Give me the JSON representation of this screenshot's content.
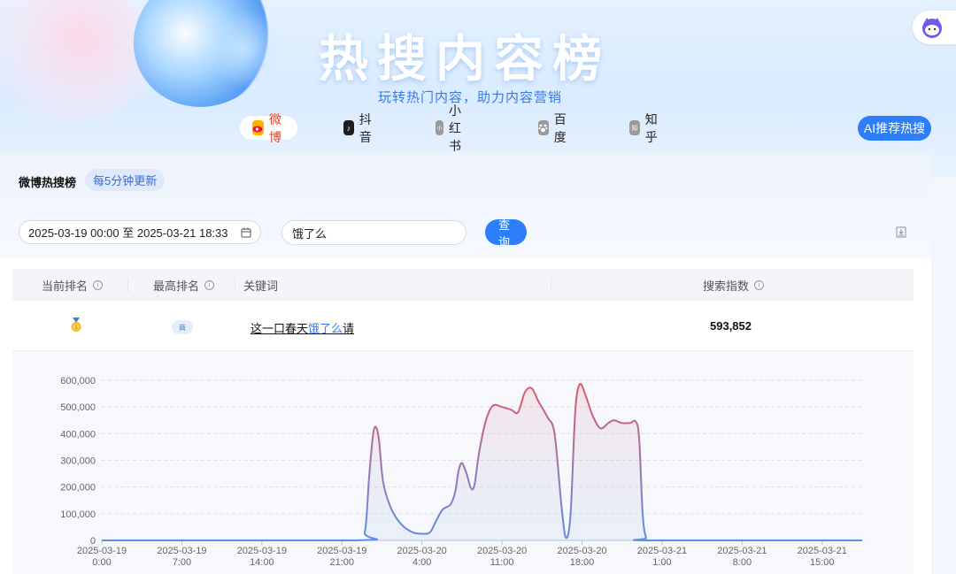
{
  "hero": {
    "title": "热搜内容榜",
    "subtitle": "玩转热门内容，助力内容营销"
  },
  "tabs": [
    {
      "label": "微博",
      "icon": "weibo-icon",
      "active": true
    },
    {
      "label": "抖音",
      "icon": "douyin-icon",
      "active": false
    },
    {
      "label": "小红书",
      "icon": "xiaohongshu-icon",
      "active": false
    },
    {
      "label": "百度",
      "icon": "baidu-icon",
      "active": false
    },
    {
      "label": "知乎",
      "icon": "zhihu-icon",
      "active": false
    }
  ],
  "ai_button": "AI推荐热搜",
  "panel": {
    "title": "微博热搜榜",
    "badge": "每5分钟更新"
  },
  "filters": {
    "date_range": "2025-03-19 00:00 至 2025-03-21 18:33",
    "keyword_value": "饿了么",
    "query_button": "查 询"
  },
  "table": {
    "headers": {
      "current_rank": "当前排名",
      "best_rank": "最高排名",
      "keyword": "关键词",
      "search_index": "搜索指数"
    },
    "row": {
      "best_rank_tag": "商",
      "keyword_prefix": "这一口春天",
      "keyword_highlight": "饿了么",
      "keyword_suffix": "请",
      "search_index": "593,852"
    }
  },
  "colors": {
    "accent": "#2d7ff9",
    "line_low": "#5b8fe6",
    "line_high": "#e05a6a"
  },
  "chart_data": {
    "type": "area",
    "title": "",
    "xlabel": "",
    "ylabel": "",
    "ylim": [
      0,
      600000
    ],
    "yticks": [
      "0",
      "100,000",
      "200,000",
      "300,000",
      "400,000",
      "500,000",
      "600,000"
    ],
    "ytick_values": [
      0,
      100000,
      200000,
      300000,
      400000,
      500000,
      600000
    ],
    "xticks": [
      [
        "2025-03-19",
        "0:00"
      ],
      [
        "2025-03-19",
        "7:00"
      ],
      [
        "2025-03-19",
        "14:00"
      ],
      [
        "2025-03-19",
        "21:00"
      ],
      [
        "2025-03-20",
        "4:00"
      ],
      [
        "2025-03-20",
        "11:00"
      ],
      [
        "2025-03-20",
        "18:00"
      ],
      [
        "2025-03-21",
        "1:00"
      ],
      [
        "2025-03-21",
        "8:00"
      ],
      [
        "2025-03-21",
        "15:00"
      ]
    ],
    "xtick_hours": [
      0,
      7,
      14,
      21,
      28,
      35,
      42,
      49,
      56,
      63
    ],
    "xlim_hours": [
      0,
      66.5
    ],
    "series": [
      {
        "values": [
          [
            0,
            0
          ],
          [
            22.2,
            0
          ],
          [
            23.0,
            30000
          ],
          [
            23.4,
            250000
          ],
          [
            23.8,
            415000
          ],
          [
            24.2,
            390000
          ],
          [
            24.6,
            220000
          ],
          [
            25.3,
            120000
          ],
          [
            26.2,
            60000
          ],
          [
            27.2,
            30000
          ],
          [
            28.0,
            25000
          ],
          [
            28.7,
            30000
          ],
          [
            29.2,
            70000
          ],
          [
            29.8,
            115000
          ],
          [
            30.5,
            135000
          ],
          [
            30.9,
            180000
          ],
          [
            31.2,
            260000
          ],
          [
            31.5,
            290000
          ],
          [
            31.9,
            250000
          ],
          [
            32.3,
            195000
          ],
          [
            32.6,
            210000
          ],
          [
            33.0,
            330000
          ],
          [
            33.6,
            450000
          ],
          [
            34.2,
            505000
          ],
          [
            35.0,
            500000
          ],
          [
            35.8,
            490000
          ],
          [
            36.4,
            480000
          ],
          [
            37.0,
            555000
          ],
          [
            37.6,
            570000
          ],
          [
            38.2,
            520000
          ],
          [
            39.0,
            460000
          ],
          [
            39.6,
            400000
          ],
          [
            40.2,
            130000
          ],
          [
            40.6,
            10000
          ],
          [
            41.0,
            100000
          ],
          [
            41.4,
            480000
          ],
          [
            41.8,
            585000
          ],
          [
            42.3,
            545000
          ],
          [
            42.9,
            470000
          ],
          [
            43.6,
            420000
          ],
          [
            44.3,
            440000
          ],
          [
            44.8,
            450000
          ],
          [
            45.5,
            440000
          ],
          [
            46.2,
            440000
          ],
          [
            46.7,
            445000
          ],
          [
            47.0,
            380000
          ],
          [
            47.3,
            100000
          ],
          [
            47.6,
            10000
          ],
          [
            48.0,
            0
          ],
          [
            66.5,
            0
          ]
        ]
      }
    ],
    "grid": true,
    "legend": "none"
  }
}
